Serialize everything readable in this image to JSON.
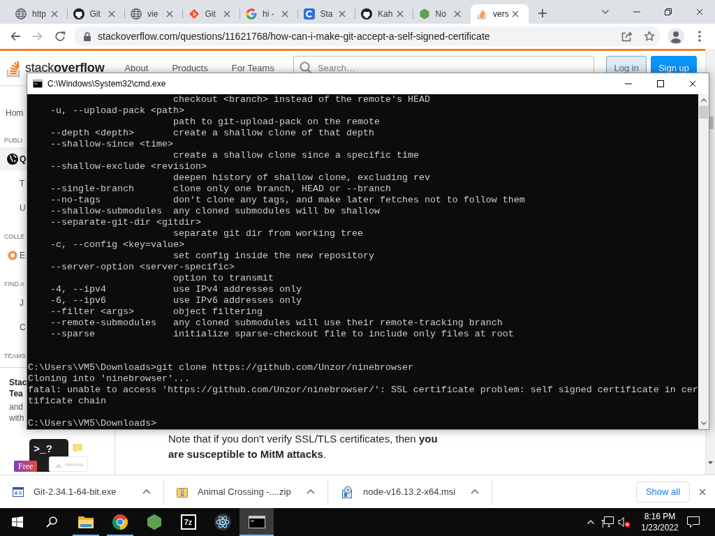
{
  "browser": {
    "tabs": [
      {
        "title": "http",
        "kind": "globe",
        "selected": false
      },
      {
        "title": "Git",
        "kind": "cat",
        "selected": false
      },
      {
        "title": "vie",
        "kind": "globe",
        "selected": false
      },
      {
        "title": "Git",
        "kind": "diamond",
        "selected": false
      },
      {
        "title": "hi -",
        "kind": "google",
        "selected": false
      },
      {
        "title": "Sta",
        "kind": "ring",
        "selected": false
      },
      {
        "title": "Kah",
        "kind": "cat",
        "selected": false
      },
      {
        "title": "No",
        "kind": "hexagon",
        "selected": false
      },
      {
        "title": "vers",
        "kind": "trays",
        "selected": true
      }
    ],
    "back": {
      "disabled": false
    },
    "forward": {
      "disabled": true
    },
    "url": "stackoverflow.com/questions/11621768/how-can-i-make-git-accept-a-self-signed-certificate"
  },
  "page": {
    "logo": "stack**overflow**",
    "nav": [
      "About",
      "Products",
      "For Teams"
    ],
    "search": {
      "placeholder": "Search…"
    },
    "buttons": [
      {
        "label": "Log in",
        "kind": "secondary"
      },
      {
        "label": "Sign up",
        "kind": "primary"
      }
    ],
    "sidebar": {
      "items": [
        {
          "kind": "home",
          "label": "Hom",
          "selected": false
        },
        {
          "kind": "heading",
          "label": "PUBLI"
        },
        {
          "kind": "globe",
          "label": "Q",
          "selected": true
        },
        {
          "kind": "sub",
          "label": "T",
          "selected": false
        },
        {
          "kind": "sub",
          "label": "U",
          "selected": false
        },
        {
          "kind": "heading",
          "label": "COLLE"
        },
        {
          "kind": "collective",
          "label": "E",
          "selected": false
        },
        {
          "kind": "heading",
          "label": "FIND A"
        },
        {
          "kind": "sub",
          "label": "J",
          "selected": false
        },
        {
          "kind": "sub",
          "label": "C",
          "selected": false
        },
        {
          "kind": "heading",
          "label": "TEAMS"
        }
      ],
      "teams_card": {
        "title_lines": [
          "Stac",
          "Tea"
        ],
        "text_lines": [
          "and",
          "with"
        ],
        "terminal_text": ">_?",
        "badge": "Free"
      }
    },
    "answer_text": "Note that if you don't verify SSL/TLS certificates, then **you are susceptible to MitM attacks**."
  },
  "console_window": {
    "title": "C:\\Windows\\System32\\cmd.exe",
    "lines": [
      {
        "kind": "text",
        "text": "                          checkout <branch> instead of the remote's HEAD"
      },
      {
        "kind": "text",
        "text": "    -u, --upload-pack <path>"
      },
      {
        "kind": "text",
        "text": "                          path to git-upload-pack on the remote"
      },
      {
        "kind": "text",
        "text": "    --depth <depth>       create a shallow clone of that depth"
      },
      {
        "kind": "text",
        "text": "    --shallow-since <time>"
      },
      {
        "kind": "text",
        "text": "                          create a shallow clone since a specific time"
      },
      {
        "kind": "text",
        "text": "    --shallow-exclude <revision>"
      },
      {
        "kind": "text",
        "text": "                          deepen history of shallow clone, excluding rev"
      },
      {
        "kind": "text",
        "text": "    --single-branch       clone only one branch, HEAD or --branch"
      },
      {
        "kind": "text",
        "text": "    --no-tags             don't clone any tags, and make later fetches not to follow them"
      },
      {
        "kind": "text",
        "text": "    --shallow-submodules  any cloned submodules will be shallow"
      },
      {
        "kind": "text",
        "text": "    --separate-git-dir <gitdir>"
      },
      {
        "kind": "text",
        "text": "                          separate git dir from working tree"
      },
      {
        "kind": "text",
        "text": "    -c, --config <key=value>"
      },
      {
        "kind": "text",
        "text": "                          set config inside the new repository"
      },
      {
        "kind": "text",
        "text": "    --server-option <server-specific>"
      },
      {
        "kind": "text",
        "text": "                          option to transmit"
      },
      {
        "kind": "text",
        "text": "    -4, --ipv4            use IPv4 addresses only"
      },
      {
        "kind": "text",
        "text": "    -6, --ipv6            use IPv6 addresses only"
      },
      {
        "kind": "text",
        "text": "    --filter <args>       object filtering"
      },
      {
        "kind": "text",
        "text": "    --remote-submodules   any cloned submodules will use their remote-tracking branch"
      },
      {
        "kind": "text",
        "text": "    --sparse              initialize sparse-checkout file to include only files at root"
      },
      {
        "kind": "blank"
      },
      {
        "kind": "blank"
      },
      {
        "kind": "text",
        "text": "C:\\Users\\VM5\\Downloads>git clone https://github.com/Unzor/ninebrowser"
      },
      {
        "kind": "text",
        "text": "Cloning into 'ninebrowser'..."
      },
      {
        "kind": "text",
        "text": "fatal: unable to access 'https://github.com/Unzor/ninebrowser/': SSL certificate problem: self signed certificate in cer"
      },
      {
        "kind": "text",
        "text": "tificate chain"
      },
      {
        "kind": "blank"
      },
      {
        "kind": "text",
        "text": "C:\\Users\\VM5\\Downloads>"
      }
    ]
  },
  "downloads": {
    "items": [
      {
        "name": "Git-2.34.1-64-bit.exe",
        "kind": "exe"
      },
      {
        "name": "Animal Crossing -....zip",
        "kind": "zip"
      },
      {
        "name": "node-v16.13.2-x64.msi",
        "kind": "msi"
      }
    ],
    "show_all": "Show all"
  },
  "taskbar": {
    "apps": [
      {
        "kind": "folder",
        "running": true,
        "selected": false
      },
      {
        "kind": "browser",
        "running": true,
        "selected": false
      },
      {
        "kind": "hexagon",
        "running": false,
        "selected": false
      },
      {
        "kind": "archiver",
        "text": "7z",
        "running": false,
        "selected": false
      },
      {
        "kind": "atom",
        "running": false,
        "selected": false
      },
      {
        "kind": "console",
        "running": true,
        "selected": true
      }
    ],
    "volume": {
      "muted": true
    },
    "time": "8:16 PM",
    "date": "1/23/2022"
  }
}
